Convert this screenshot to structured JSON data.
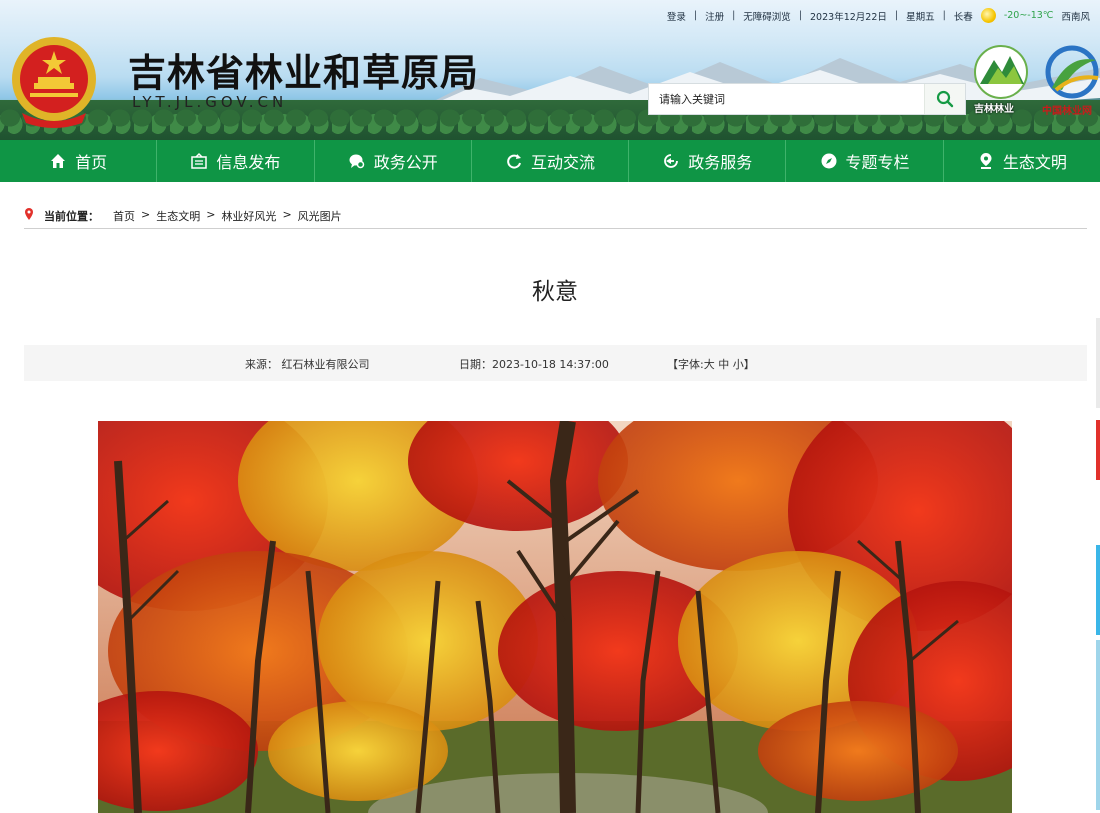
{
  "topbar": {
    "login": "登录",
    "register": "注册",
    "accessible": "无障碍浏览",
    "date": "2023年12月22日",
    "weekday": "星期五",
    "city": "长春",
    "temperature": "-20~-13℃",
    "wind": "西南风"
  },
  "site": {
    "title": "吉林省林业和草原局",
    "domain": "LYT.JL.GOV.CN"
  },
  "search": {
    "placeholder": "请输入关键词"
  },
  "logos": {
    "jilin_forestry": "吉林林业",
    "china_forestry": "中国林业网"
  },
  "nav": [
    {
      "label": "首页",
      "icon": "home-icon"
    },
    {
      "label": "信息发布",
      "icon": "info-board-icon"
    },
    {
      "label": "政务公开",
      "icon": "chat-search-icon"
    },
    {
      "label": "互动交流",
      "icon": "refresh-icon"
    },
    {
      "label": "政务服务",
      "icon": "service-icon"
    },
    {
      "label": "专题专栏",
      "icon": "compass-icon"
    },
    {
      "label": "生态文明",
      "icon": "location-icon"
    }
  ],
  "breadcrumb": {
    "label": "当前位置：",
    "items": [
      "首页",
      "生态文明",
      "林业好风光",
      "风光图片"
    ],
    "separator": ">"
  },
  "article": {
    "title": "秋意",
    "source": "来源：  红石林业有限公司",
    "date": "日期：2023-10-18 14:37:00",
    "font_size": "【字体:大 中 小】"
  },
  "colors": {
    "nav_green": "#0f9545",
    "accent_red": "#e2312b"
  }
}
